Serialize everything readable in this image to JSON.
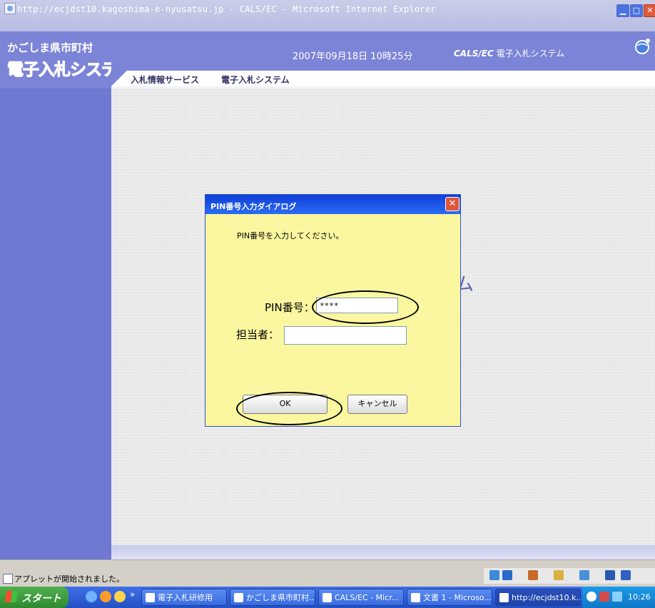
{
  "window": {
    "title": "http://ecjdst10.kagoshima-e-nyusatsu.jp - CALS/EC - Microsoft Internet Explorer",
    "minimize_icon": "minimize-icon",
    "maximize_icon": "maximize-icon",
    "close_icon": "close-icon"
  },
  "header": {
    "logo_line1": "かごしま県市町村",
    "logo_line2": "電子入札システム",
    "datetime": "2007年09月18日 10時25分",
    "system_prefix": "CALS/EC",
    "system_name": "電子入札システム",
    "nav": [
      "入札情報サービス",
      "電子入札システム"
    ]
  },
  "main": {
    "background_fragment": "ム"
  },
  "dialog": {
    "title": "PIN番号入力ダイアログ",
    "message": "PIN番号を入力してください。",
    "pin_label": "PIN番号：",
    "pin_value": "****",
    "person_label": "担当者：",
    "person_value": "",
    "ok_label": "OK",
    "cancel_label": "キャンセル"
  },
  "statusbar": {
    "text": "アプレットが開始されました。"
  },
  "taskbar": {
    "start_label": "スタート",
    "tasks": [
      "電子入札研修用",
      "かごしま県市町村...",
      "CALS/EC - Micr...",
      "文書 1 - Microso...",
      "http://ecjdst10.k..."
    ],
    "clock": "10:26"
  },
  "colors": {
    "banner": "#7b84d6",
    "dialog_bg": "#fbf7a0",
    "dialog_title": "#1a4fe0",
    "taskbar": "#2f5fd8"
  }
}
